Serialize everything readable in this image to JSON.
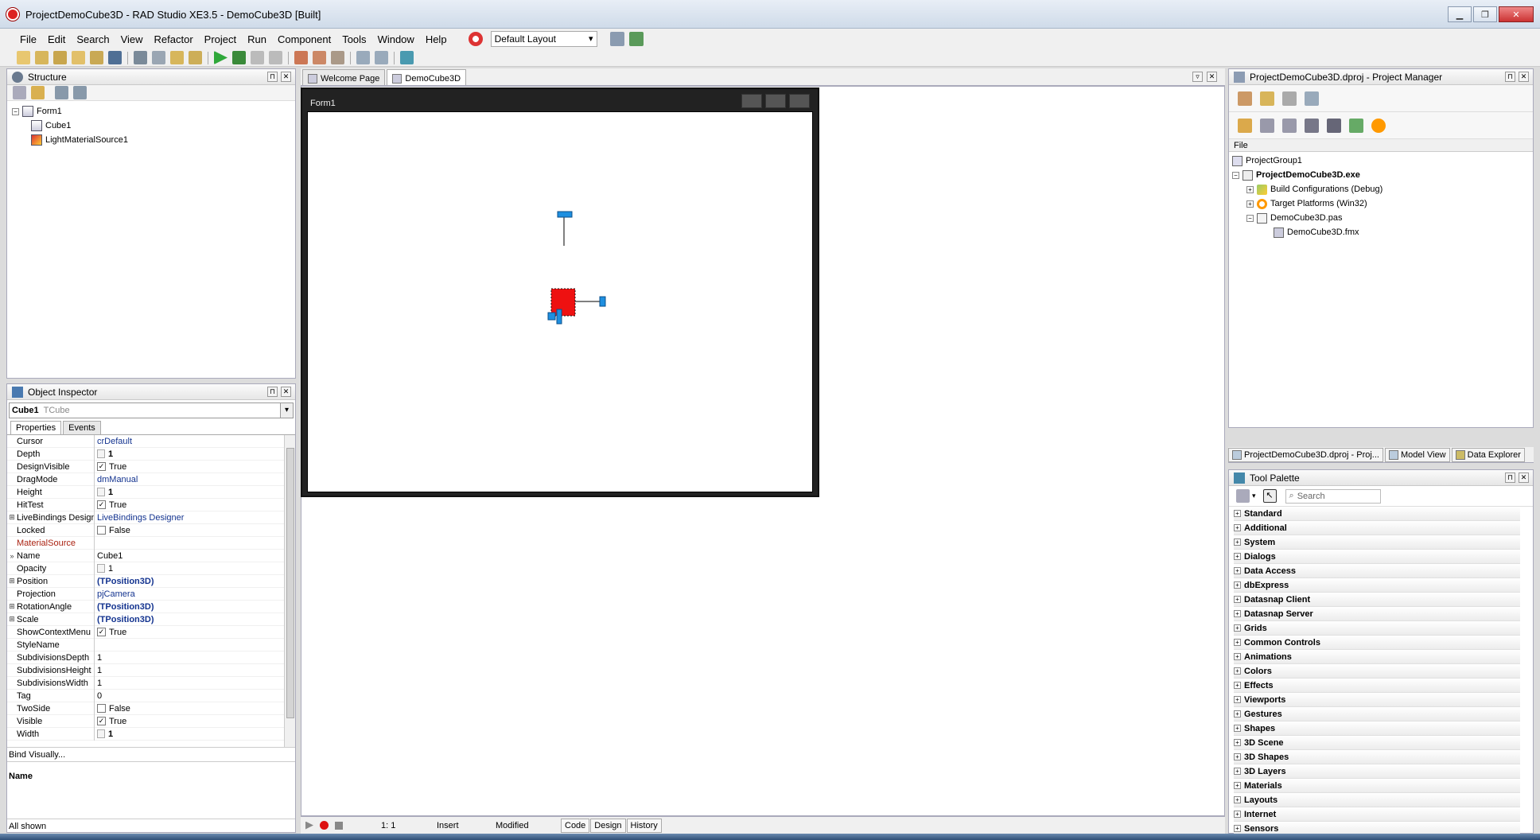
{
  "window": {
    "title": "ProjectDemoCube3D - RAD Studio XE3.5 - DemoCube3D [Built]"
  },
  "menu": {
    "items": [
      "File",
      "Edit",
      "Search",
      "View",
      "Refactor",
      "Project",
      "Run",
      "Component",
      "Tools",
      "Window",
      "Help"
    ],
    "layout_value": "Default Layout"
  },
  "structure": {
    "title": "Structure",
    "tree": {
      "root": "Form1",
      "children": [
        "Cube1",
        "LightMaterialSource1"
      ]
    }
  },
  "inspector": {
    "title": "Object Inspector",
    "object_name": "Cube1",
    "object_type": "TCube",
    "tabs": [
      "Properties",
      "Events"
    ],
    "properties": [
      {
        "name": "Cursor",
        "value": "crDefault"
      },
      {
        "name": "Depth",
        "value": "1"
      },
      {
        "name": "DesignVisible",
        "value": "True"
      },
      {
        "name": "DragMode",
        "value": "dmManual"
      },
      {
        "name": "Height",
        "value": "1"
      },
      {
        "name": "HitTest",
        "value": "True"
      },
      {
        "name": "LiveBindings Designer",
        "value": "LiveBindings Designer"
      },
      {
        "name": "Locked",
        "value": "False"
      },
      {
        "name": "MaterialSource",
        "value": ""
      },
      {
        "name": "Name",
        "value": "Cube1"
      },
      {
        "name": "Opacity",
        "value": "1"
      },
      {
        "name": "Position",
        "value": "(TPosition3D)"
      },
      {
        "name": "Projection",
        "value": "pjCamera"
      },
      {
        "name": "RotationAngle",
        "value": "(TPosition3D)"
      },
      {
        "name": "Scale",
        "value": "(TPosition3D)"
      },
      {
        "name": "ShowContextMenu",
        "value": "True"
      },
      {
        "name": "StyleName",
        "value": ""
      },
      {
        "name": "SubdivisionsDepth",
        "value": "1"
      },
      {
        "name": "SubdivisionsHeight",
        "value": "1"
      },
      {
        "name": "SubdivisionsWidth",
        "value": "1"
      },
      {
        "name": "Tag",
        "value": "0"
      },
      {
        "name": "TwoSide",
        "value": "False"
      },
      {
        "name": "Visible",
        "value": "True"
      },
      {
        "name": "Width",
        "value": "1"
      }
    ],
    "bind_visually": "Bind Visually...",
    "desc_title": "Name",
    "status": "All shown"
  },
  "editor": {
    "tabs": [
      "Welcome Page",
      "DemoCube3D"
    ],
    "form_title": "Form1",
    "status": {
      "position": "1: 1",
      "mode": "Insert",
      "modified": "Modified"
    },
    "bottom_tabs": [
      "Code",
      "Design",
      "History"
    ]
  },
  "project_manager": {
    "title": "ProjectDemoCube3D.dproj - Project Manager",
    "column": "File",
    "tree": {
      "group": "ProjectGroup1",
      "project": "ProjectDemoCube3D.exe",
      "build": "Build Configurations (Debug)",
      "platforms": "Target Platforms (Win32)",
      "unit": "DemoCube3D.pas",
      "form": "DemoCube3D.fmx"
    },
    "tabs": [
      "ProjectDemoCube3D.dproj - Proj...",
      "Model View",
      "Data Explorer"
    ]
  },
  "palette": {
    "title": "Tool Palette",
    "search_placeholder": "Search",
    "categories": [
      "Standard",
      "Additional",
      "System",
      "Dialogs",
      "Data Access",
      "dbExpress",
      "Datasnap Client",
      "Datasnap Server",
      "Grids",
      "Common Controls",
      "Animations",
      "Colors",
      "Effects",
      "Viewports",
      "Gestures",
      "Shapes",
      "3D Scene",
      "3D Shapes",
      "3D Layers",
      "Materials",
      "Layouts",
      "Internet",
      "Sensors"
    ]
  },
  "colors": {
    "accent_blue": "#13338f",
    "cube_red": "#ee1111",
    "handle_blue": "#1e8fe0"
  }
}
